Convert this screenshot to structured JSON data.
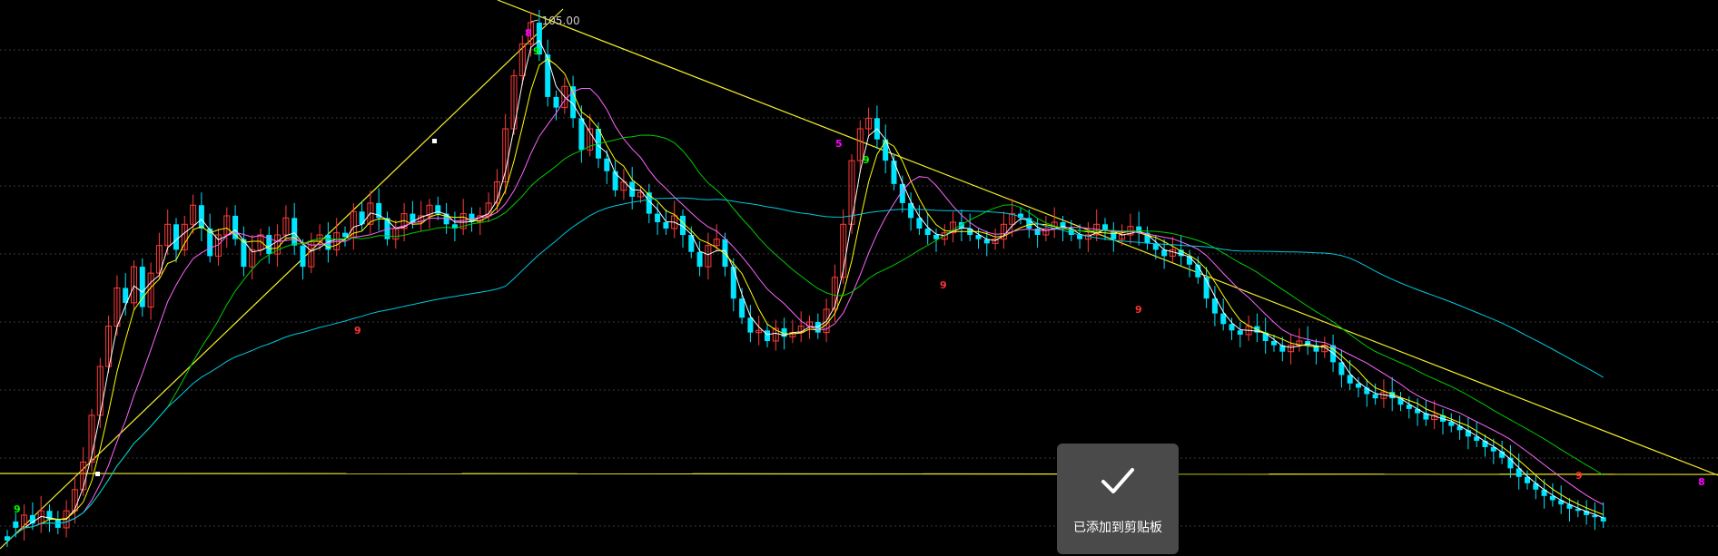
{
  "chart_data": {
    "type": "candlestick",
    "price_label": "105.00",
    "up_color": "#ff3b3b",
    "down_color": "#00e5ff",
    "grid": true,
    "ma_colors": [
      "#ffffff",
      "#ffff00",
      "#ff66ff",
      "#00cc00",
      "#00c8e0"
    ],
    "trendline_color": "#f2ee2a",
    "td_count_colors": {
      "buy": "#ff00ff",
      "sell": "#ff00ff",
      "nine_up": "#00ff00",
      "nine_down": "#ff3333"
    },
    "candles": [
      [
        16,
        12
      ],
      [
        30,
        24
      ],
      [
        24,
        36
      ],
      [
        36,
        28
      ],
      [
        28,
        40
      ],
      [
        40,
        32
      ],
      [
        32,
        24
      ],
      [
        24,
        40
      ],
      [
        40,
        60
      ],
      [
        60,
        86
      ],
      [
        86,
        130
      ],
      [
        130,
        176
      ],
      [
        176,
        214
      ],
      [
        214,
        250
      ],
      [
        250,
        236
      ],
      [
        236,
        270
      ],
      [
        270,
        232
      ],
      [
        232,
        264
      ],
      [
        264,
        290
      ],
      [
        290,
        310
      ],
      [
        310,
        286
      ],
      [
        286,
        310
      ],
      [
        310,
        328
      ],
      [
        328,
        306
      ],
      [
        306,
        280
      ],
      [
        280,
        300
      ],
      [
        300,
        318
      ],
      [
        318,
        296
      ],
      [
        296,
        270
      ],
      [
        270,
        286
      ],
      [
        286,
        300
      ],
      [
        300,
        282
      ],
      [
        282,
        300
      ],
      [
        300,
        316
      ],
      [
        316,
        290
      ],
      [
        290,
        270
      ],
      [
        270,
        294
      ],
      [
        294,
        300
      ],
      [
        300,
        286
      ],
      [
        286,
        302
      ],
      [
        302,
        298
      ],
      [
        298,
        322
      ],
      [
        322,
        310
      ],
      [
        310,
        330
      ],
      [
        330,
        316
      ],
      [
        316,
        296
      ],
      [
        296,
        306
      ],
      [
        306,
        320
      ],
      [
        320,
        312
      ],
      [
        312,
        318
      ],
      [
        318,
        328
      ],
      [
        328,
        320
      ],
      [
        320,
        310
      ],
      [
        310,
        306
      ],
      [
        306,
        320
      ],
      [
        320,
        312
      ],
      [
        312,
        318
      ],
      [
        318,
        330
      ],
      [
        330,
        350
      ],
      [
        350,
        400
      ],
      [
        400,
        450
      ],
      [
        450,
        480
      ],
      [
        480,
        500
      ],
      [
        500,
        470
      ],
      [
        470,
        430
      ],
      [
        430,
        420
      ],
      [
        420,
        440
      ],
      [
        440,
        410
      ],
      [
        410,
        380
      ],
      [
        380,
        400
      ],
      [
        400,
        372
      ],
      [
        372,
        360
      ],
      [
        360,
        342
      ],
      [
        342,
        350
      ],
      [
        350,
        336
      ],
      [
        336,
        340
      ],
      [
        340,
        320
      ],
      [
        320,
        312
      ],
      [
        312,
        306
      ],
      [
        306,
        318
      ],
      [
        318,
        300
      ],
      [
        300,
        284
      ],
      [
        284,
        270
      ],
      [
        270,
        290
      ],
      [
        290,
        296
      ],
      [
        296,
        270
      ],
      [
        270,
        240
      ],
      [
        240,
        222
      ],
      [
        222,
        208
      ],
      [
        208,
        210
      ],
      [
        210,
        200
      ],
      [
        200,
        212
      ],
      [
        212,
        204
      ],
      [
        204,
        208
      ],
      [
        208,
        214
      ],
      [
        214,
        218
      ],
      [
        218,
        208
      ],
      [
        208,
        230
      ],
      [
        230,
        260
      ],
      [
        260,
        310
      ],
      [
        310,
        370
      ],
      [
        370,
        400
      ],
      [
        400,
        410
      ],
      [
        410,
        390
      ],
      [
        390,
        370
      ],
      [
        370,
        348
      ],
      [
        348,
        330
      ],
      [
        330,
        316
      ],
      [
        316,
        306
      ],
      [
        306,
        300
      ],
      [
        300,
        296
      ],
      [
        296,
        302
      ],
      [
        302,
        312
      ],
      [
        312,
        306
      ],
      [
        306,
        300
      ],
      [
        300,
        296
      ],
      [
        296,
        292
      ],
      [
        292,
        296
      ],
      [
        296,
        310
      ],
      [
        310,
        320
      ],
      [
        320,
        316
      ],
      [
        316,
        306
      ],
      [
        306,
        300
      ],
      [
        300,
        306
      ],
      [
        306,
        312
      ],
      [
        312,
        306
      ],
      [
        306,
        300
      ],
      [
        300,
        296
      ],
      [
        296,
        300
      ],
      [
        300,
        310
      ],
      [
        310,
        304
      ],
      [
        304,
        296
      ],
      [
        296,
        300
      ],
      [
        300,
        308
      ],
      [
        308,
        302
      ],
      [
        302,
        292
      ],
      [
        292,
        286
      ],
      [
        286,
        280
      ],
      [
        280,
        286
      ],
      [
        286,
        280
      ],
      [
        280,
        272
      ],
      [
        272,
        260
      ],
      [
        260,
        240
      ],
      [
        240,
        226
      ],
      [
        226,
        216
      ],
      [
        216,
        210
      ],
      [
        210,
        206
      ],
      [
        206,
        214
      ],
      [
        214,
        208
      ],
      [
        208,
        200
      ],
      [
        200,
        196
      ],
      [
        196,
        190
      ],
      [
        190,
        196
      ],
      [
        196,
        200
      ],
      [
        200,
        196
      ],
      [
        196,
        190
      ],
      [
        190,
        196
      ],
      [
        196,
        180
      ],
      [
        180,
        168
      ],
      [
        168,
        160
      ],
      [
        160,
        156
      ],
      [
        156,
        150
      ],
      [
        150,
        146
      ],
      [
        146,
        152
      ],
      [
        152,
        146
      ],
      [
        146,
        140
      ],
      [
        140,
        136
      ],
      [
        136,
        132
      ],
      [
        132,
        126
      ],
      [
        126,
        130
      ],
      [
        130,
        124
      ],
      [
        124,
        120
      ],
      [
        120,
        116
      ],
      [
        116,
        110
      ],
      [
        110,
        106
      ],
      [
        106,
        100
      ],
      [
        100,
        96
      ],
      [
        96,
        90
      ],
      [
        90,
        80
      ],
      [
        80,
        72
      ],
      [
        72,
        66
      ],
      [
        66,
        60
      ],
      [
        60,
        54
      ],
      [
        54,
        50
      ],
      [
        50,
        46
      ],
      [
        46,
        42
      ],
      [
        42,
        40
      ],
      [
        40,
        36
      ],
      [
        36,
        34
      ],
      [
        34,
        30
      ]
    ]
  },
  "toast": {
    "icon": "checkmark-icon",
    "message": "已添加到剪贴板"
  }
}
